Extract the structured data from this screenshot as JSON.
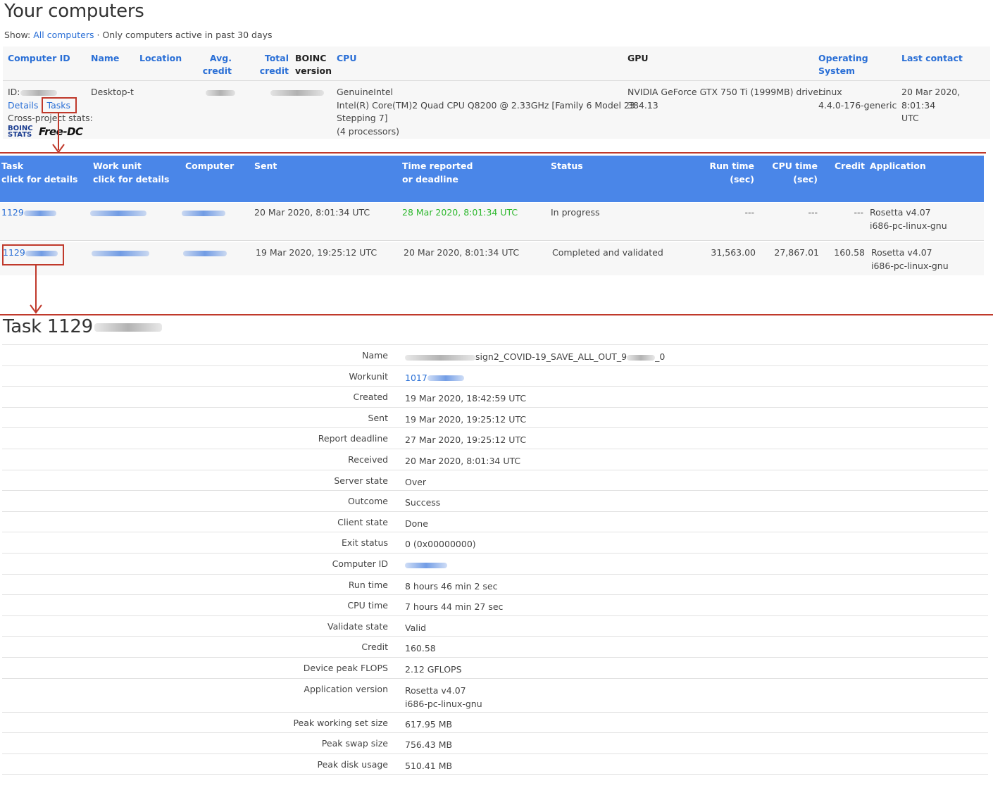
{
  "page": {
    "title": "Your computers"
  },
  "show": {
    "label": "Show:",
    "all_link": "All computers",
    "separator": " · ",
    "only_active": "Only computers active in past 30 days"
  },
  "computers_table": {
    "headers": {
      "computer_id": "Computer ID",
      "name": "Name",
      "location": "Location",
      "avg_credit_1": "Avg.",
      "avg_credit_2": "credit",
      "total_credit_1": "Total",
      "total_credit_2": "credit",
      "boinc_version_1": "BOINC",
      "boinc_version_2": "version",
      "cpu": "CPU",
      "gpu": "GPU",
      "os_1": "Operating",
      "os_2": "System",
      "last_contact": "Last contact"
    },
    "row": {
      "id_label": "ID:",
      "details_link": "Details",
      "divider": "|",
      "tasks_link": "Tasks",
      "cross_project": "Cross-project stats:",
      "name": "Desktop-t",
      "cpu_line1": "GenuineIntel",
      "cpu_line2": "Intel(R) Core(TM)2 Quad CPU Q8200 @ 2.33GHz [Family 6 Model 23",
      "cpu_line3": "Stepping 7]",
      "cpu_line4": "(4 processors)",
      "gpu_line1": "NVIDIA GeForce GTX 750 Ti (1999MB) driver:",
      "gpu_line2": "384.13",
      "os_line1": "Linux",
      "os_line2": "4.4.0-176-generic",
      "last_contact_line1": "20 Mar 2020, 8:01:34",
      "last_contact_line2": "UTC",
      "logo_boinc": "BOINC STATS",
      "logo_freedc": "Free-DC"
    }
  },
  "tasks_table": {
    "headers": {
      "task_1": "Task",
      "task_2": "click for details",
      "workunit_1": "Work unit",
      "workunit_2": "click for details",
      "computer": "Computer",
      "sent": "Sent",
      "reported_1": "Time reported",
      "reported_2": "or deadline",
      "status": "Status",
      "run_time_1": "Run time",
      "run_time_2": "(sec)",
      "cpu_time_1": "CPU time",
      "cpu_time_2": "(sec)",
      "credit": "Credit",
      "application": "Application"
    },
    "rows": [
      {
        "task": "1129",
        "sent": "20 Mar 2020, 8:01:34 UTC",
        "reported": "28 Mar 2020, 8:01:34 UTC",
        "status": "In progress",
        "run_time": "---",
        "cpu_time": "---",
        "credit": "---",
        "app_1": "Rosetta v4.07",
        "app_2": "i686-pc-linux-gnu"
      },
      {
        "task": "1129",
        "sent": "19 Mar 2020, 19:25:12 UTC",
        "reported": "20 Mar 2020, 8:01:34 UTC",
        "status": "Completed and validated",
        "run_time": "31,563.00",
        "cpu_time": "27,867.01",
        "credit": "160.58",
        "app_1": "Rosetta v4.07",
        "app_2": "i686-pc-linux-gnu"
      }
    ]
  },
  "task_detail": {
    "title": "Task 1129",
    "rows": [
      {
        "label": "Name",
        "value": "sign2_COVID-19_SAVE_ALL_OUT_9",
        "value_suffix": "_0"
      },
      {
        "label": "Workunit",
        "value": "1017"
      },
      {
        "label": "Created",
        "value": "19 Mar 2020, 18:42:59 UTC"
      },
      {
        "label": "Sent",
        "value": "19 Mar 2020, 19:25:12 UTC"
      },
      {
        "label": "Report deadline",
        "value": "27 Mar 2020, 19:25:12 UTC"
      },
      {
        "label": "Received",
        "value": "20 Mar 2020, 8:01:34 UTC"
      },
      {
        "label": "Server state",
        "value": "Over"
      },
      {
        "label": "Outcome",
        "value": "Success"
      },
      {
        "label": "Client state",
        "value": "Done"
      },
      {
        "label": "Exit status",
        "value": "0 (0x00000000)"
      },
      {
        "label": "Computer ID",
        "value": ""
      },
      {
        "label": "Run time",
        "value": "8 hours 46 min 2 sec"
      },
      {
        "label": "CPU time",
        "value": "7 hours 44 min 27 sec"
      },
      {
        "label": "Validate state",
        "value": "Valid"
      },
      {
        "label": "Credit",
        "value": "160.58"
      },
      {
        "label": "Device peak FLOPS",
        "value": "2.12 GFLOPS"
      },
      {
        "label": "Application version",
        "value": "Rosetta v4.07",
        "value_2": "i686-pc-linux-gnu"
      },
      {
        "label": "Peak working set size",
        "value": "617.95 MB"
      },
      {
        "label": "Peak swap size",
        "value": "756.43 MB"
      },
      {
        "label": "Peak disk usage",
        "value": "510.41 MB"
      }
    ]
  },
  "colors": {
    "link": "#2a6fd6",
    "header_bg": "#4a86e8",
    "annotation": "#c0392b",
    "in_progress_deadline": "#2eb82e"
  }
}
